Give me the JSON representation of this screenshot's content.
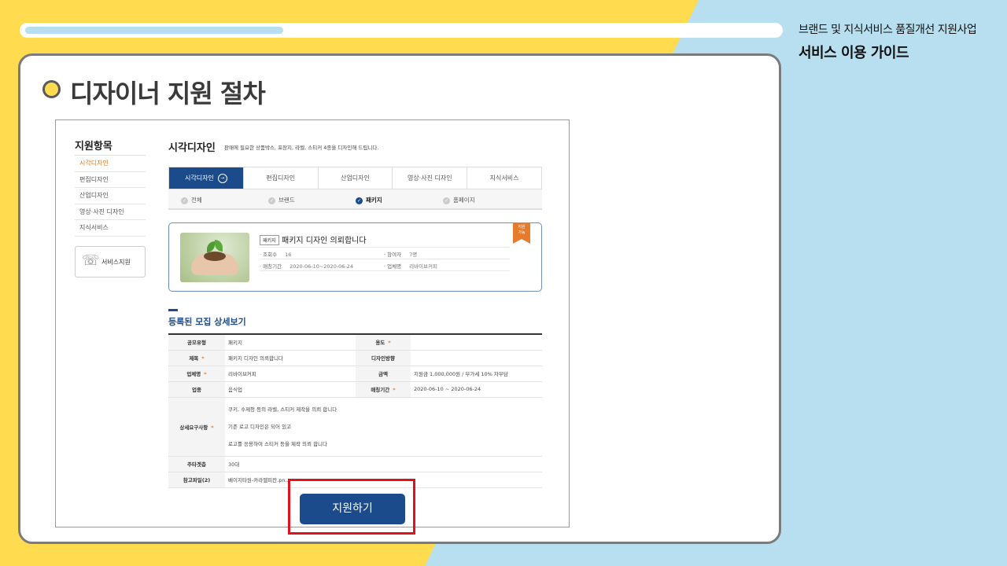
{
  "header": {
    "brand_subtitle": "브랜드 및 지식서비스 품질개선 지원사업",
    "brand_title": "서비스 이용 가이드"
  },
  "page_title": "디자이너 지원 절차",
  "colors": {
    "bg_yellow": "#fedb4f",
    "bg_blue": "#b7dff0",
    "accent_navy": "#1c4b8b",
    "accent_orange": "#e57b2b",
    "highlight_red": "#e0121b"
  },
  "sidebar": {
    "heading": "지원항목",
    "items": [
      {
        "label": "시각디자인",
        "active": true
      },
      {
        "label": "편집디자인"
      },
      {
        "label": "산업디자인"
      },
      {
        "label": "영상·사진 디자인"
      },
      {
        "label": "지식서비스"
      }
    ],
    "service_label": "서비스지원",
    "service_icon": "person-headset-icon"
  },
  "main": {
    "title": "시각디자인",
    "description": "판매에 필요한 상품박스, 포장지, 라벨, 스티커 4종을 디자인해 드립니다.",
    "tabs": [
      {
        "label": "시각디자인",
        "active": true,
        "icon": "→"
      },
      {
        "label": "편집디자인"
      },
      {
        "label": "산업디자인"
      },
      {
        "label": "영상·사진 디자인"
      },
      {
        "label": "지식서비스"
      }
    ],
    "subtabs": [
      {
        "label": "전체"
      },
      {
        "label": "브랜드"
      },
      {
        "label": "패키지",
        "active": true
      },
      {
        "label": "홈페이지"
      }
    ],
    "project": {
      "tag": "패키지",
      "title": "패키지 디자인 의뢰합니다",
      "views_label": "· 조회수",
      "views": "16",
      "participants_label": "· 참여자",
      "participants": "7명",
      "period_label": "· 매칭기간",
      "period": "2020-06-10~2020-06-24",
      "company_label": "· 업체명",
      "company": "리바이브커피",
      "ribbon": "지원\n가능"
    },
    "section_title": "등록된 모집 상세보기",
    "detail": {
      "type_label": "공모유형",
      "type": "패키지",
      "usage_label": "용도",
      "usage": "",
      "title_label": "제목",
      "title": "패키지 디자인 의뢰합니다",
      "direction_label": "디자인방향",
      "direction": "",
      "company_label": "업체명",
      "company": "리바이브커피",
      "amount_label": "금액",
      "amount": "지원금 1,000,000원 / 부가세 10% 자부담",
      "industry_label": "업종",
      "industry": "음식업",
      "period_label": "매칭기간",
      "period": "2020-06-10 ~ 2020-06-24",
      "requirements_label": "상세요구사항",
      "requirements": [
        "쿠키, 수제청 등의 라벨, 스티커 제작을 의뢰 합니다",
        "기존 로고 디자인은 되어 있고",
        "로고를 응용하여 스티커 등을 제작 의뢰 합니다"
      ],
      "target_label": "주타겟층",
      "target": "30대",
      "file_label": "참고파일(2)",
      "file": "베이지타원-카라멜피칸.pn..."
    },
    "apply_button": "지원하기"
  }
}
